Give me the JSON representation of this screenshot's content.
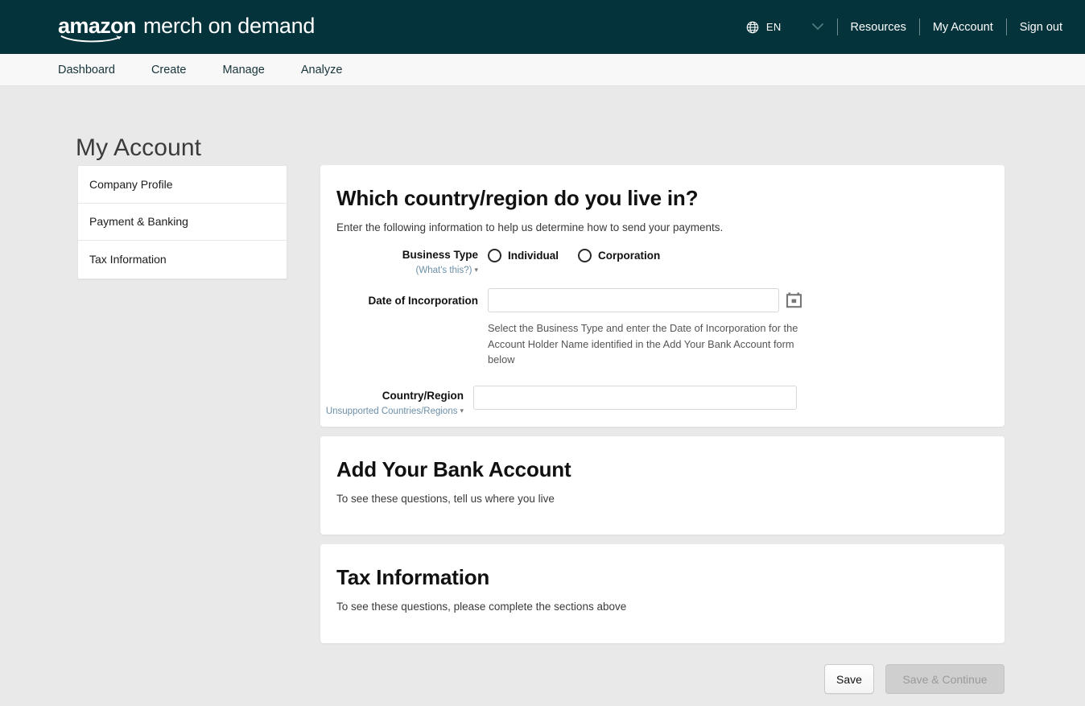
{
  "header": {
    "brand_amazon": "amazon",
    "brand_rest": "merch on demand",
    "language_code": "EN",
    "links": [
      {
        "label": "Resources"
      },
      {
        "label": "My Account"
      },
      {
        "label": "Sign out"
      }
    ]
  },
  "navbar": {
    "items": [
      {
        "label": "Dashboard"
      },
      {
        "label": "Create"
      },
      {
        "label": "Manage"
      },
      {
        "label": "Analyze"
      }
    ]
  },
  "page": {
    "title": "My Account"
  },
  "sidebar": {
    "items": [
      {
        "label": "Company Profile"
      },
      {
        "label": "Payment & Banking"
      },
      {
        "label": "Tax Information"
      }
    ]
  },
  "country_card": {
    "title": "Which country/region do you live in?",
    "subtitle": "Enter the following information to help us determine how to send your payments.",
    "business_type": {
      "label": "Business Type",
      "help_link": "(What's this?)",
      "options": [
        {
          "label": "Individual",
          "selected": false
        },
        {
          "label": "Corporation",
          "selected": false
        }
      ]
    },
    "date_of_incorporation": {
      "label": "Date of Incorporation",
      "value": "",
      "placeholder": "",
      "helper": "Select the Business Type and enter the Date of Incorporation for the Account Holder Name identified in the Add Your Bank Account form below"
    },
    "country_region": {
      "label": "Country/Region",
      "help_link": "Unsupported Countries/Regions",
      "value": "",
      "placeholder": ""
    }
  },
  "bank_card": {
    "title": "Add Your Bank Account",
    "message": "To see these questions, tell us where you live"
  },
  "tax_card": {
    "title": "Tax Information",
    "message": "To see these questions, please complete the sections above"
  },
  "footer": {
    "save_label": "Save",
    "save_continue_label": "Save & Continue"
  },
  "colors": {
    "header_bg": "#04333b",
    "nav_bg": "#f8f8f8",
    "page_bg": "#e9e9e9",
    "card_bg": "#ffffff",
    "link_blue": "#6b8fa8",
    "disabled_btn": "#cfcfcf"
  }
}
